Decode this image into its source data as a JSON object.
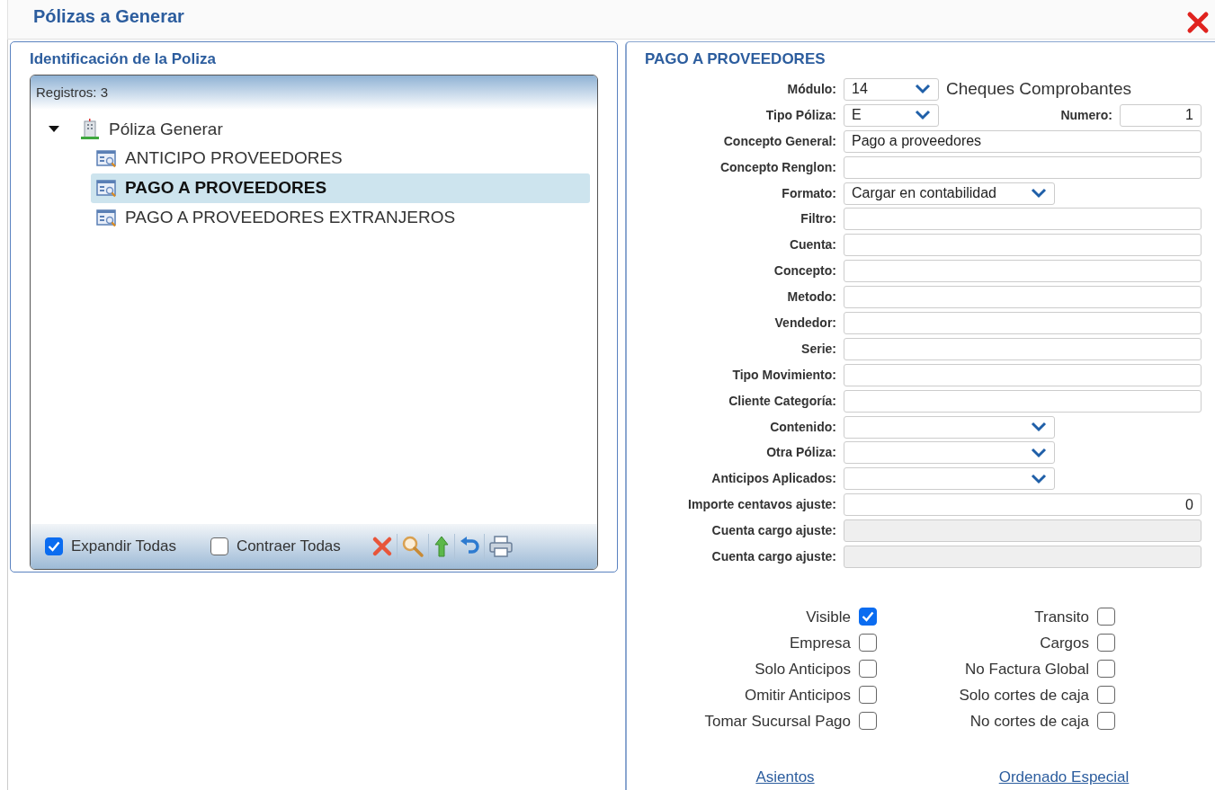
{
  "window": {
    "title": "Pólizas a Generar"
  },
  "left_panel": {
    "title": "Identificación de la Poliza",
    "grid_header": "Registros: 3",
    "tree": [
      {
        "label": "Póliza Generar",
        "expanded": true,
        "children": [
          {
            "label": "ANTICIPO PROVEEDORES",
            "selected": false
          },
          {
            "label": "PAGO A PROVEEDORES",
            "selected": true
          },
          {
            "label": "PAGO A PROVEEDORES EXTRANJEROS",
            "selected": false
          }
        ]
      }
    ],
    "toolbar": {
      "options": [
        {
          "label": "Expandir Todas",
          "checked": true
        },
        {
          "label": "Contraer Todas",
          "checked": false
        }
      ]
    }
  },
  "right_panel": {
    "title": "PAGO A PROVEEDORES",
    "fields": [
      {
        "label": "Módulo:",
        "kind": "short_select",
        "value": "14",
        "note": "Cheques Comprobantes"
      },
      {
        "label": "Tipo Póliza:",
        "kind": "short_select",
        "value": "E",
        "extra": {
          "label": "Numero:",
          "value": "1"
        }
      },
      {
        "label": "Concepto General:",
        "kind": "text",
        "value": "Pago a proveedores"
      },
      {
        "label": "Concepto Renglon:",
        "kind": "text"
      },
      {
        "label": "Formato:",
        "kind": "select",
        "value": "Cargar en contabilidad"
      },
      {
        "label": "Filtro:",
        "kind": "text"
      },
      {
        "label": "Cuenta:",
        "kind": "text"
      },
      {
        "label": "Concepto:",
        "kind": "text"
      },
      {
        "label": "Metodo:",
        "kind": "text"
      },
      {
        "label": "Vendedor:",
        "kind": "text"
      },
      {
        "label": "Serie:",
        "kind": "text"
      },
      {
        "label": "Tipo Movimiento:",
        "kind": "text"
      },
      {
        "label": "Cliente Categoría:",
        "kind": "text"
      },
      {
        "label": "Contenido:",
        "kind": "select"
      },
      {
        "label": "Otra Póliza:",
        "kind": "select"
      },
      {
        "label": "Anticipos Aplicados:",
        "kind": "select"
      },
      {
        "label": "Importe centavos ajuste:",
        "kind": "number",
        "value": "0"
      },
      {
        "label": "Cuenta cargo ajuste:",
        "kind": "disabled"
      },
      {
        "label": "Cuenta cargo ajuste:",
        "kind": "disabled"
      }
    ],
    "checkboxes_left": [
      {
        "label": "Visible",
        "checked": true
      },
      {
        "label": "Empresa",
        "checked": false
      },
      {
        "label": "Solo Anticipos",
        "checked": false
      },
      {
        "label": "Omitir Anticipos",
        "checked": false
      },
      {
        "label": "Tomar Sucursal Pago",
        "checked": false
      }
    ],
    "checkboxes_right": [
      {
        "label": "Transito",
        "checked": false
      },
      {
        "label": "Cargos",
        "checked": false
      },
      {
        "label": "No Factura Global",
        "checked": false
      },
      {
        "label": "Solo cortes de caja",
        "checked": false
      },
      {
        "label": "No cortes de caja",
        "checked": false
      }
    ],
    "links": [
      "Asientos",
      "Ordenado Especial"
    ]
  }
}
